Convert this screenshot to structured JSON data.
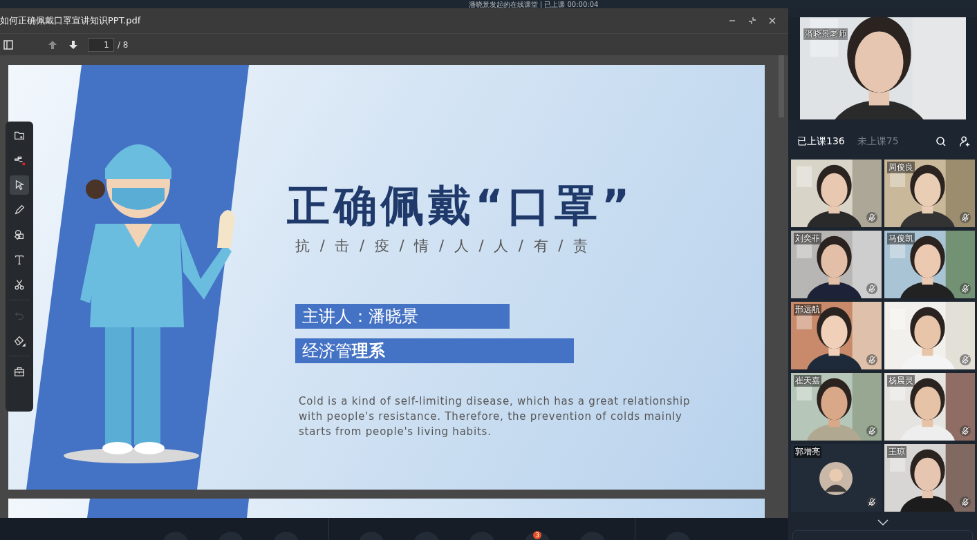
{
  "window": {
    "title": "潘晓景发起的在线课堂 | 已上课 00:00:04"
  },
  "viewer": {
    "file_name": "如何正确佩戴口罩宣讲知识PPT.pdf",
    "page": "1",
    "page_total": "/ 8",
    "tools": [
      {
        "kind": "add-folder",
        "selected": false,
        "disabled": false
      },
      {
        "kind": "layers",
        "selected": false,
        "disabled": false
      },
      {
        "kind": "pointer",
        "selected": true,
        "disabled": false
      },
      {
        "kind": "pen",
        "selected": false,
        "disabled": false
      },
      {
        "kind": "shapes",
        "selected": false,
        "disabled": false
      },
      {
        "kind": "text",
        "selected": false,
        "disabled": false
      },
      {
        "kind": "scissors",
        "selected": false,
        "disabled": false
      },
      {
        "kind": "undo",
        "selected": false,
        "disabled": true
      },
      {
        "kind": "eraser",
        "selected": false,
        "disabled": false
      },
      {
        "kind": "toolbox",
        "selected": false,
        "disabled": false
      }
    ],
    "slide": {
      "title": "正确佩戴“口罩”",
      "subtitle": "抗 / 击 / 疫 / 情 / 人 / 人 / 有 / 责",
      "speaker": "主讲人：潘晓景",
      "department": "经济管**理系**",
      "paragraph": "Cold is a kind of self-limiting disease, which has a great relationship with people's resistance. Therefore, the prevention of colds mainly starts from people's living habits."
    }
  },
  "bottom_bar": {
    "groups": [
      [
        {
          "kind": "round"
        },
        {
          "kind": "round"
        },
        {
          "kind": "round"
        }
      ],
      [
        {
          "kind": "round"
        },
        {
          "kind": "round"
        },
        {
          "kind": "round"
        },
        {
          "kind": "round",
          "badge": "3"
        },
        {
          "kind": "round"
        }
      ],
      [
        {
          "kind": "round"
        }
      ]
    ]
  },
  "teacher": {
    "name": "潘晓景老师",
    "kind": "picture"
  },
  "tabs": [
    {
      "label": "已上课136",
      "selected": true
    },
    {
      "label": "未上课75",
      "selected": false
    }
  ],
  "participants": [
    {
      "kind": "video",
      "muted": true
    },
    {
      "name": "周俊良",
      "kind": "video",
      "muted": true
    },
    {
      "name": "刘奕菲",
      "kind": "video",
      "muted": true
    },
    {
      "name": "马俊凯",
      "kind": "video",
      "muted": true
    },
    {
      "name": "邢远航",
      "kind": "video",
      "muted": true
    },
    {
      "kind": "video",
      "muted": true
    },
    {
      "name": "崔天嘉",
      "kind": "video",
      "muted": true
    },
    {
      "name": "杨晨灵",
      "kind": "video",
      "muted": true
    },
    {
      "name": "郭增亮",
      "kind": "avatar",
      "muted": true
    },
    {
      "name": "王琼",
      "kind": "video",
      "muted": true
    }
  ]
}
